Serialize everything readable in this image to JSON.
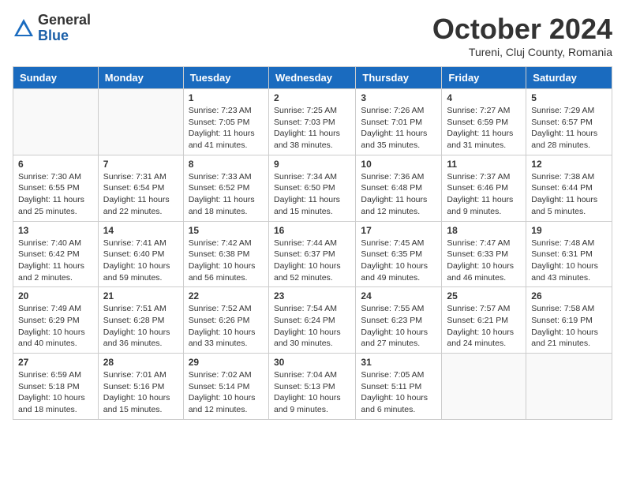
{
  "header": {
    "logo_general": "General",
    "logo_blue": "Blue",
    "month_title": "October 2024",
    "location": "Tureni, Cluj County, Romania"
  },
  "weekdays": [
    "Sunday",
    "Monday",
    "Tuesday",
    "Wednesday",
    "Thursday",
    "Friday",
    "Saturday"
  ],
  "weeks": [
    [
      {
        "day": "",
        "empty": true
      },
      {
        "day": "",
        "empty": true
      },
      {
        "day": "1",
        "sunrise": "7:23 AM",
        "sunset": "7:05 PM",
        "daylight": "11 hours and 41 minutes."
      },
      {
        "day": "2",
        "sunrise": "7:25 AM",
        "sunset": "7:03 PM",
        "daylight": "11 hours and 38 minutes."
      },
      {
        "day": "3",
        "sunrise": "7:26 AM",
        "sunset": "7:01 PM",
        "daylight": "11 hours and 35 minutes."
      },
      {
        "day": "4",
        "sunrise": "7:27 AM",
        "sunset": "6:59 PM",
        "daylight": "11 hours and 31 minutes."
      },
      {
        "day": "5",
        "sunrise": "7:29 AM",
        "sunset": "6:57 PM",
        "daylight": "11 hours and 28 minutes."
      }
    ],
    [
      {
        "day": "6",
        "sunrise": "7:30 AM",
        "sunset": "6:55 PM",
        "daylight": "11 hours and 25 minutes."
      },
      {
        "day": "7",
        "sunrise": "7:31 AM",
        "sunset": "6:54 PM",
        "daylight": "11 hours and 22 minutes."
      },
      {
        "day": "8",
        "sunrise": "7:33 AM",
        "sunset": "6:52 PM",
        "daylight": "11 hours and 18 minutes."
      },
      {
        "day": "9",
        "sunrise": "7:34 AM",
        "sunset": "6:50 PM",
        "daylight": "11 hours and 15 minutes."
      },
      {
        "day": "10",
        "sunrise": "7:36 AM",
        "sunset": "6:48 PM",
        "daylight": "11 hours and 12 minutes."
      },
      {
        "day": "11",
        "sunrise": "7:37 AM",
        "sunset": "6:46 PM",
        "daylight": "11 hours and 9 minutes."
      },
      {
        "day": "12",
        "sunrise": "7:38 AM",
        "sunset": "6:44 PM",
        "daylight": "11 hours and 5 minutes."
      }
    ],
    [
      {
        "day": "13",
        "sunrise": "7:40 AM",
        "sunset": "6:42 PM",
        "daylight": "11 hours and 2 minutes."
      },
      {
        "day": "14",
        "sunrise": "7:41 AM",
        "sunset": "6:40 PM",
        "daylight": "10 hours and 59 minutes."
      },
      {
        "day": "15",
        "sunrise": "7:42 AM",
        "sunset": "6:38 PM",
        "daylight": "10 hours and 56 minutes."
      },
      {
        "day": "16",
        "sunrise": "7:44 AM",
        "sunset": "6:37 PM",
        "daylight": "10 hours and 52 minutes."
      },
      {
        "day": "17",
        "sunrise": "7:45 AM",
        "sunset": "6:35 PM",
        "daylight": "10 hours and 49 minutes."
      },
      {
        "day": "18",
        "sunrise": "7:47 AM",
        "sunset": "6:33 PM",
        "daylight": "10 hours and 46 minutes."
      },
      {
        "day": "19",
        "sunrise": "7:48 AM",
        "sunset": "6:31 PM",
        "daylight": "10 hours and 43 minutes."
      }
    ],
    [
      {
        "day": "20",
        "sunrise": "7:49 AM",
        "sunset": "6:29 PM",
        "daylight": "10 hours and 40 minutes."
      },
      {
        "day": "21",
        "sunrise": "7:51 AM",
        "sunset": "6:28 PM",
        "daylight": "10 hours and 36 minutes."
      },
      {
        "day": "22",
        "sunrise": "7:52 AM",
        "sunset": "6:26 PM",
        "daylight": "10 hours and 33 minutes."
      },
      {
        "day": "23",
        "sunrise": "7:54 AM",
        "sunset": "6:24 PM",
        "daylight": "10 hours and 30 minutes."
      },
      {
        "day": "24",
        "sunrise": "7:55 AM",
        "sunset": "6:23 PM",
        "daylight": "10 hours and 27 minutes."
      },
      {
        "day": "25",
        "sunrise": "7:57 AM",
        "sunset": "6:21 PM",
        "daylight": "10 hours and 24 minutes."
      },
      {
        "day": "26",
        "sunrise": "7:58 AM",
        "sunset": "6:19 PM",
        "daylight": "10 hours and 21 minutes."
      }
    ],
    [
      {
        "day": "27",
        "sunrise": "6:59 AM",
        "sunset": "5:18 PM",
        "daylight": "10 hours and 18 minutes."
      },
      {
        "day": "28",
        "sunrise": "7:01 AM",
        "sunset": "5:16 PM",
        "daylight": "10 hours and 15 minutes."
      },
      {
        "day": "29",
        "sunrise": "7:02 AM",
        "sunset": "5:14 PM",
        "daylight": "10 hours and 12 minutes."
      },
      {
        "day": "30",
        "sunrise": "7:04 AM",
        "sunset": "5:13 PM",
        "daylight": "10 hours and 9 minutes."
      },
      {
        "day": "31",
        "sunrise": "7:05 AM",
        "sunset": "5:11 PM",
        "daylight": "10 hours and 6 minutes."
      },
      {
        "day": "",
        "empty": true
      },
      {
        "day": "",
        "empty": true
      }
    ]
  ]
}
